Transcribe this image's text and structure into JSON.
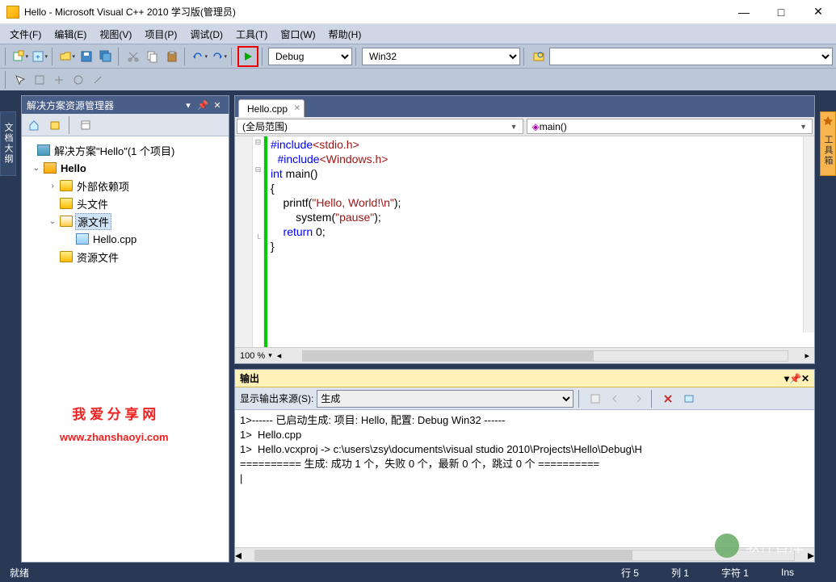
{
  "window": {
    "title": "Hello - Microsoft Visual C++ 2010 学习版(管理员)"
  },
  "menu": [
    "文件(F)",
    "编辑(E)",
    "视图(V)",
    "项目(P)",
    "调试(D)",
    "工具(T)",
    "窗口(W)",
    "帮助(H)"
  ],
  "toolbar": {
    "debug": "Debug",
    "platform": "Win32"
  },
  "sidetabs": {
    "left": "文档大纲",
    "right": "工具箱"
  },
  "solution": {
    "title": "解决方案资源管理器",
    "root": "解决方案\"Hello\"(1 个项目)",
    "project": "Hello",
    "folders": {
      "ext": "外部依赖项",
      "header": "头文件",
      "source": "源文件",
      "resource": "资源文件"
    },
    "file": "Hello.cpp"
  },
  "editor": {
    "tab": "Hello.cpp",
    "scope": "(全局范围)",
    "member": "main()",
    "zoom": "100 %",
    "code": {
      "l1a": "#include",
      "l1b": "<stdio.h>",
      "l2a": "#include",
      "l2b": "<Windows.h>",
      "l3a": "int",
      "l3b": " main()",
      "l4": "{",
      "l5a": "    printf(",
      "l5b": "\"Hello, World!\\n\"",
      "l5c": ");",
      "l6a": "        system(",
      "l6b": "\"pause\"",
      "l6c": ");",
      "l7a": "    return",
      "l7b": " 0;",
      "l8": "}"
    }
  },
  "output": {
    "title": "输出",
    "srclabel": "显示输出来源(S):",
    "source": "生成",
    "lines": [
      "1>------ 已启动生成: 项目: Hello, 配置: Debug Win32 ------",
      "1>  Hello.cpp",
      "1>  Hello.vcxproj -> c:\\users\\zsy\\documents\\visual studio 2010\\Projects\\Hello\\Debug\\H",
      "========== 生成: 成功 1 个，失败 0 个，最新 0 个，跳过 0 个 =========="
    ]
  },
  "statusbar": {
    "ready": "就绪",
    "line": "行 5",
    "col": "列 1",
    "ch": "字符 1",
    "ins": "Ins"
  },
  "watermark": {
    "t1": "我 爱 分 享 网",
    "t2": "www.zhanshaoyi.com"
  },
  "brand": "软件智库"
}
